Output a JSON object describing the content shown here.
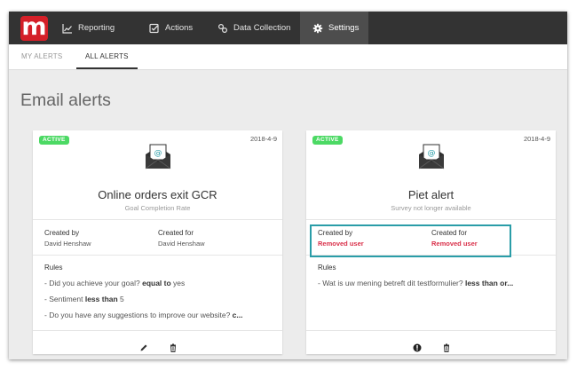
{
  "nav": {
    "logo": "m",
    "items": [
      {
        "label": "Reporting",
        "icon": "chart-line-icon"
      },
      {
        "label": "Actions",
        "icon": "check-square-icon"
      },
      {
        "label": "Data Collection",
        "icon": "link-icon"
      },
      {
        "label": "Settings",
        "icon": "gear-icon",
        "active": true
      }
    ]
  },
  "subnav": {
    "tabs": [
      {
        "label": "MY ALERTS",
        "active": false
      },
      {
        "label": "ALL ALERTS",
        "active": true
      }
    ]
  },
  "page": {
    "title": "Email alerts"
  },
  "cards": [
    {
      "status": "ACTIVE",
      "date": "2018-4-9",
      "title": "Online orders exit GCR",
      "subtitle": "Goal Completion Rate",
      "created_by_label": "Created by",
      "created_by": "David Henshaw",
      "created_for_label": "Created for",
      "created_for": "David Henshaw",
      "rules_label": "Rules",
      "rules": [
        {
          "prefix": "- Did you achieve your goal? ",
          "op": "equal to",
          "suffix": " yes"
        },
        {
          "prefix": "- Sentiment ",
          "op": "less than",
          "suffix": " 5"
        },
        {
          "prefix": "- Do you have any suggestions to improve our website? ",
          "op": "c...",
          "suffix": ""
        }
      ],
      "actions": [
        "pencil-icon",
        "trash-icon"
      ]
    },
    {
      "status": "ACTIVE",
      "date": "2018-4-9",
      "title": "Piet alert",
      "subtitle": "Survey not longer available",
      "created_by_label": "Created by",
      "created_by": "Removed user",
      "created_for_label": "Created for",
      "created_for": "Removed user",
      "rules_label": "Rules",
      "rules": [
        {
          "prefix": "- Wat is uw mening betreft dit testformulier? ",
          "op": "less than or...",
          "suffix": ""
        }
      ],
      "actions": [
        "exclamation-circle-icon",
        "trash-icon"
      ]
    }
  ],
  "colors": {
    "brand": "#d41f28",
    "nav_bg": "#333333",
    "badge": "#4cd964",
    "removed_user": "#d9304a",
    "highlight": "#2a9da8"
  }
}
